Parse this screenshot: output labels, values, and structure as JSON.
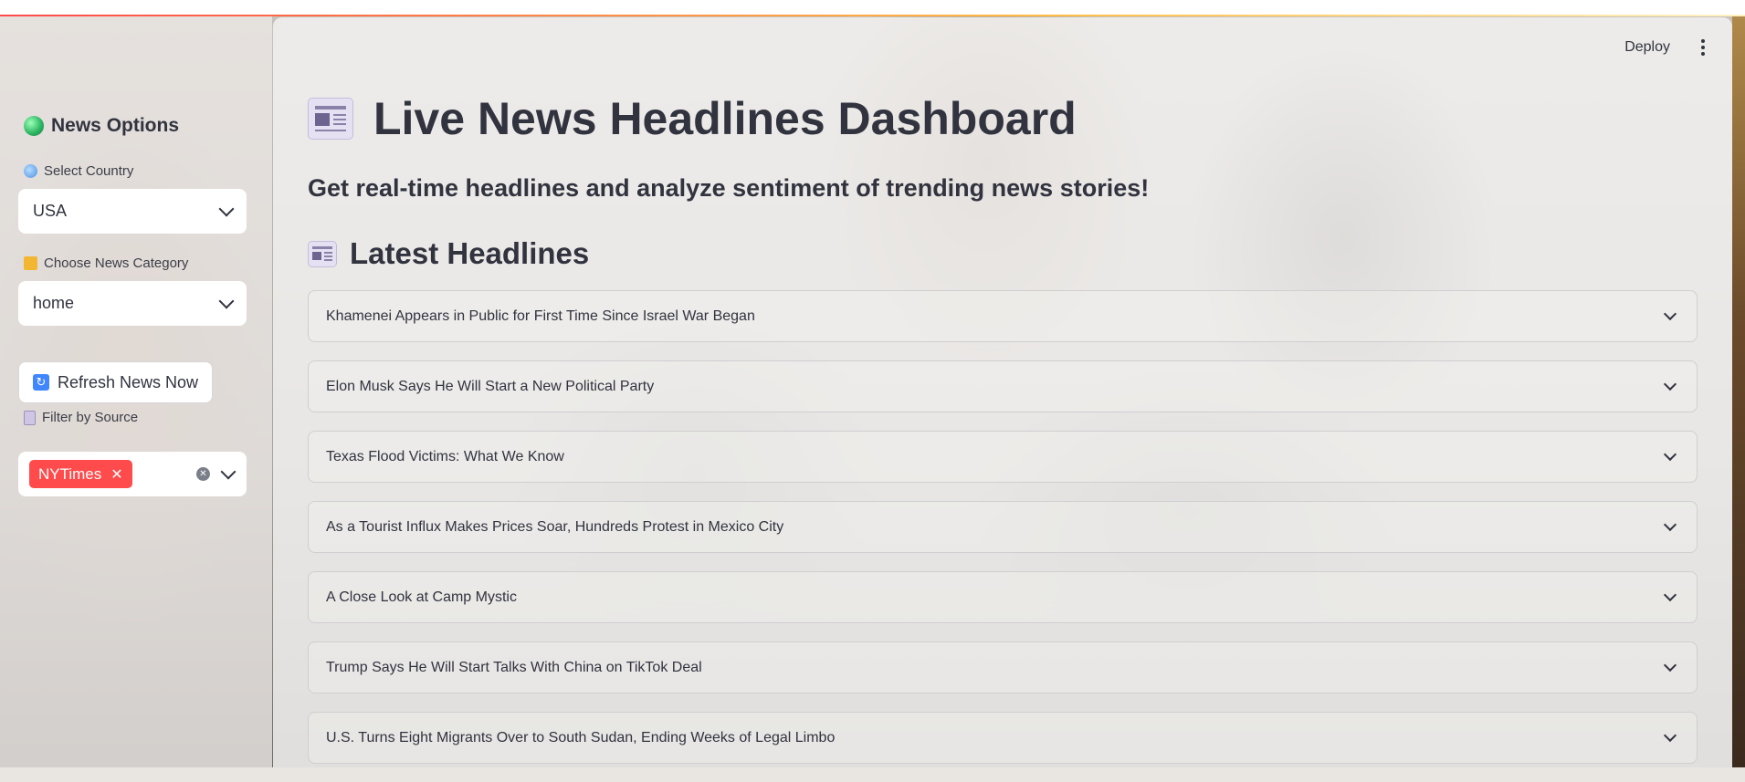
{
  "header": {
    "deploy_label": "Deploy"
  },
  "sidebar": {
    "title": "News Options",
    "country": {
      "label": "Select Country",
      "value": "USA"
    },
    "category": {
      "label": "Choose News Category",
      "value": "home"
    },
    "refresh_label": "Refresh News Now",
    "source": {
      "label": "Filter by Source",
      "selected": [
        "NYTimes"
      ]
    }
  },
  "main": {
    "title": "Live News Headlines Dashboard",
    "subtitle": "Get real-time headlines and analyze sentiment of trending news stories!",
    "section_title": "Latest Headlines",
    "headlines": [
      "Khamenei Appears in Public for First Time Since Israel War Began",
      "Elon Musk Says He Will Start a New Political Party",
      "Texas Flood Victims: What We Know",
      "As a Tourist Influx Makes Prices Soar, Hundreds Protest in Mexico City",
      "A Close Look at Camp Mystic",
      "Trump Says He Will Start Talks With China on TikTok Deal",
      "U.S. Turns Eight Migrants Over to South Sudan, Ending Weeks of Legal Limbo"
    ]
  },
  "colors": {
    "accent": "#ff4b4b",
    "text": "#31333f"
  }
}
